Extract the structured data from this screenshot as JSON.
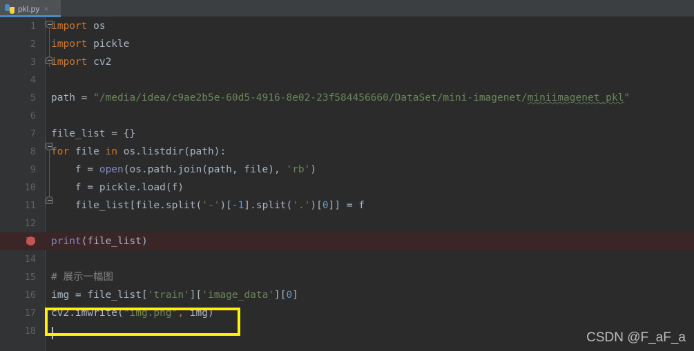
{
  "window": {
    "background_color": "#2B2B2B",
    "tabbar_color": "#3C3F41"
  },
  "tab": {
    "icon": "python-file-icon",
    "filename": "pkl.py",
    "close_glyph": "×",
    "active_indicator_color": "#4A88C7"
  },
  "editor": {
    "theme": "darcula",
    "breakpoint_line": 13,
    "breakpoint_color": "#C75450",
    "highlight_row_color": "#3A2527",
    "caret_line": 18,
    "lines": [
      {
        "n": "1",
        "tokens": [
          {
            "t": "import",
            "c": "kw"
          },
          {
            "t": " os",
            "c": "plain"
          }
        ]
      },
      {
        "n": "2",
        "tokens": [
          {
            "t": "import",
            "c": "kw"
          },
          {
            "t": " pickle",
            "c": "plain"
          }
        ]
      },
      {
        "n": "3",
        "tokens": [
          {
            "t": "import",
            "c": "kw"
          },
          {
            "t": " cv2",
            "c": "plain"
          }
        ]
      },
      {
        "n": "4",
        "tokens": []
      },
      {
        "n": "5",
        "tokens": [
          {
            "t": "path = ",
            "c": "plain"
          },
          {
            "t": "\"/media/idea/c9ae2b5e-60d5-4916-8e02-23f584456660/DataSet/mini-imagenet/",
            "c": "str"
          },
          {
            "t": "miniimagenet_pkl",
            "c": "str typo"
          },
          {
            "t": "\"",
            "c": "str"
          }
        ]
      },
      {
        "n": "6",
        "tokens": []
      },
      {
        "n": "7",
        "tokens": [
          {
            "t": "file_list = {}",
            "c": "plain"
          }
        ]
      },
      {
        "n": "8",
        "tokens": [
          {
            "t": "for",
            "c": "kw"
          },
          {
            "t": " file ",
            "c": "plain"
          },
          {
            "t": "in",
            "c": "kw"
          },
          {
            "t": " os.listdir(path):",
            "c": "plain"
          }
        ]
      },
      {
        "n": "9",
        "tokens": [
          {
            "t": "    f = ",
            "c": "plain"
          },
          {
            "t": "open",
            "c": "bi"
          },
          {
            "t": "(os.path.join(path, file), ",
            "c": "plain"
          },
          {
            "t": "'rb'",
            "c": "str"
          },
          {
            "t": ")",
            "c": "plain"
          }
        ]
      },
      {
        "n": "10",
        "tokens": [
          {
            "t": "    f = pickle.load(f)",
            "c": "plain"
          }
        ]
      },
      {
        "n": "11",
        "tokens": [
          {
            "t": "    file_list[file.split(",
            "c": "plain"
          },
          {
            "t": "'-'",
            "c": "str"
          },
          {
            "t": ")[",
            "c": "plain"
          },
          {
            "t": "-1",
            "c": "num"
          },
          {
            "t": "].split(",
            "c": "plain"
          },
          {
            "t": "'.'",
            "c": "str"
          },
          {
            "t": ")[",
            "c": "plain"
          },
          {
            "t": "0",
            "c": "num"
          },
          {
            "t": "]] = f",
            "c": "plain"
          }
        ]
      },
      {
        "n": "12",
        "tokens": []
      },
      {
        "n": "13",
        "tokens": [
          {
            "t": "print",
            "c": "bi"
          },
          {
            "t": "(file_list)",
            "c": "plain"
          }
        ]
      },
      {
        "n": "14",
        "tokens": []
      },
      {
        "n": "15",
        "tokens": [
          {
            "t": "# 展示一幅图",
            "c": "cmt"
          }
        ]
      },
      {
        "n": "16",
        "tokens": [
          {
            "t": "img = file_list[",
            "c": "plain"
          },
          {
            "t": "'train'",
            "c": "str"
          },
          {
            "t": "][",
            "c": "plain"
          },
          {
            "t": "'image_data'",
            "c": "str"
          },
          {
            "t": "][",
            "c": "plain"
          },
          {
            "t": "0",
            "c": "num"
          },
          {
            "t": "]",
            "c": "plain"
          }
        ]
      },
      {
        "n": "17",
        "tokens": [
          {
            "t": "cv2.imwrite(",
            "c": "plain"
          },
          {
            "t": "\"img.png\"",
            "c": "str"
          },
          {
            "t": ",",
            "c": "kw"
          },
          {
            "t": " img)",
            "c": "plain"
          }
        ]
      },
      {
        "n": "18",
        "tokens": []
      }
    ]
  },
  "annotation": {
    "color": "#FFF200",
    "label": "highlight-box-line-17"
  },
  "watermark": {
    "text": "CSDN @F_aF_a"
  }
}
